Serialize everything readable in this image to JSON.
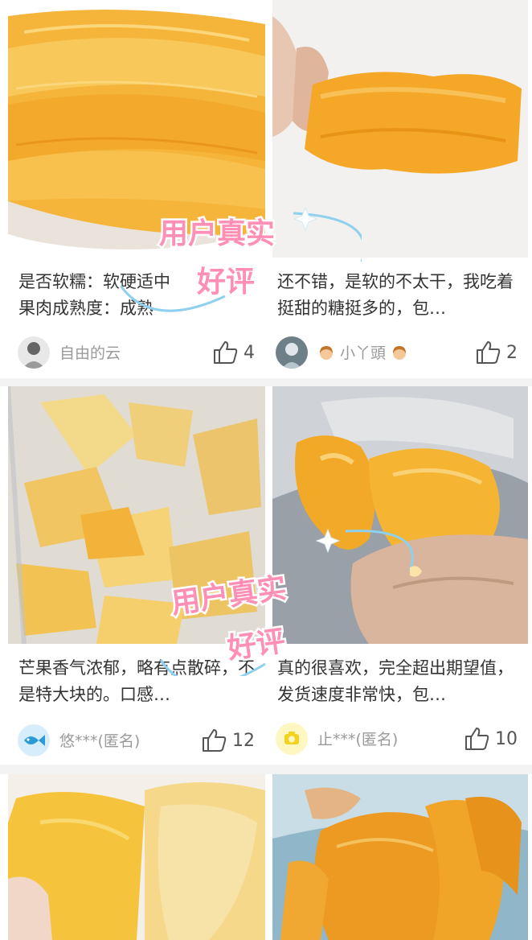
{
  "overlay_badge": {
    "line1": "用户真实",
    "line2": "好评"
  },
  "reviews": [
    {
      "caption": "是否软糯：软硬适中\n果肉成熟度：成熟",
      "user": "自由的云",
      "likes": "4",
      "photo_icon": "dried-mango-stack-photo"
    },
    {
      "caption": "还不错，是软的不太干，我吃着挺甜的糖挺多的，包…",
      "user": "小丫頭",
      "likes": "2",
      "photo_icon": "hand-holding-mango-photo"
    },
    {
      "caption": "芒果香气浓郁，略有点散碎，不是特大块的。口感…",
      "user": "悠***(匿名)",
      "likes": "12",
      "photo_icon": "mango-bag-photo"
    },
    {
      "caption": "真的很喜欢，完全超出期望值，发货速度非常快，包…",
      "user": "止***(匿名)",
      "likes": "10",
      "photo_icon": "hand-holding-mango-slice-photo"
    },
    {
      "photo_icon": "mango-slices-closeup-photo"
    },
    {
      "photo_icon": "mango-in-package-photo"
    }
  ],
  "colors": {
    "mango": "#f2a531",
    "mango_light": "#f8c85a",
    "background": "#f3f3f3",
    "overlay_pink": "#ff8fb5",
    "overlay_blue": "#8fd0ee"
  }
}
